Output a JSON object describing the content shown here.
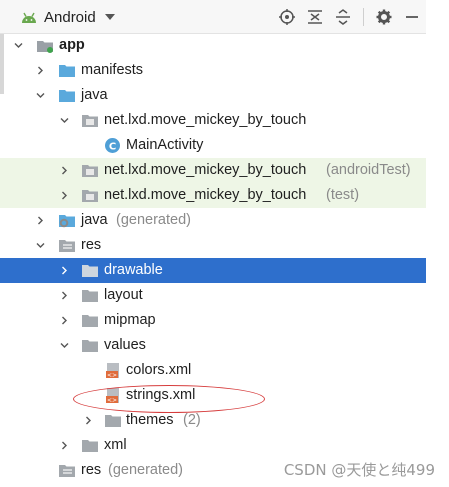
{
  "toolbar": {
    "view_label": "Android",
    "icons": [
      "locate-icon",
      "collapse-all-icon",
      "expand-all-icon",
      "settings-icon",
      "hide-icon"
    ]
  },
  "tree": {
    "app": "app",
    "manifests": "manifests",
    "java": "java",
    "pkg_main": "net.lxd.move_mickey_by_touch",
    "main_activity": "MainActivity",
    "pkg_android_test": "net.lxd.move_mickey_by_touch",
    "pkg_android_test_suffix": "(androidTest)",
    "pkg_test": "net.lxd.move_mickey_by_touch",
    "pkg_test_suffix": "(test)",
    "java_generated": "java",
    "java_generated_suffix": "(generated)",
    "res": "res",
    "drawable": "drawable",
    "layout": "layout",
    "mipmap": "mipmap",
    "values": "values",
    "colors": "colors.xml",
    "strings": "strings.xml",
    "themes": "themes",
    "themes_count": "(2)",
    "xml": "xml",
    "res_generated": "res",
    "res_generated_suffix": "(generated)"
  },
  "colors": {
    "selection": "#2e6fcc",
    "highlight_green": "#eef6e6",
    "folder_blue": "#5aa9dc",
    "annotation_red": "#d63c3c"
  },
  "watermark": "CSDN @天使と纯499"
}
